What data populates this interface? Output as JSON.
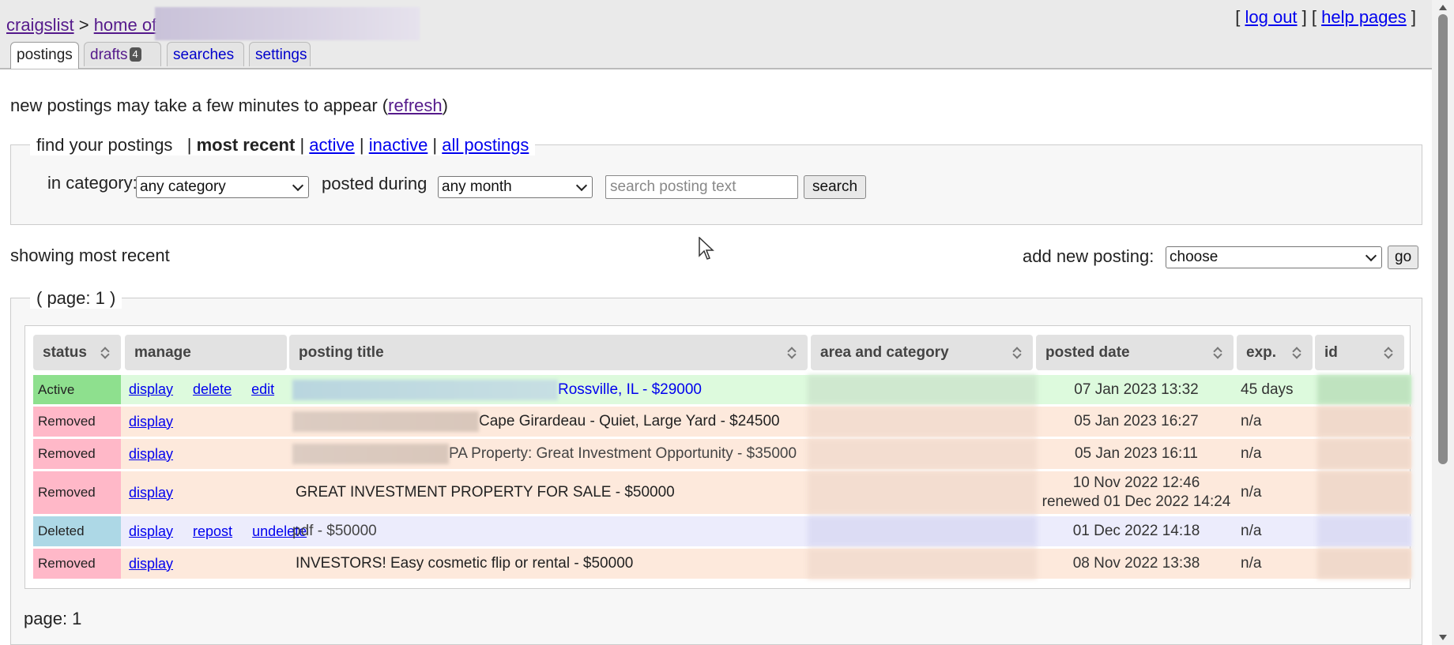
{
  "header": {
    "breadcrumb_root": "craigslist",
    "breadcrumb_sep": ">",
    "breadcrumb_home": "home of",
    "logout_label": "log out",
    "help_label": "help pages"
  },
  "tabs": [
    {
      "label": "postings"
    },
    {
      "label": "drafts",
      "badge": "4"
    },
    {
      "label": "searches"
    },
    {
      "label": "settings"
    }
  ],
  "notice": {
    "text": "new postings may take a few minutes to appear (",
    "refresh": "refresh",
    "close": ")"
  },
  "find": {
    "legend": "find your postings",
    "most_recent": "most recent",
    "active": "active",
    "inactive": "inactive",
    "all": "all postings",
    "in_category_label": "in category:",
    "category_value": "any category",
    "posted_during_label": "posted during",
    "month_value": "any month",
    "search_placeholder": "search posting text",
    "search_button": "search"
  },
  "showing": "showing most recent",
  "add_posting": {
    "label": "add new posting:",
    "value": "choose",
    "go": "go"
  },
  "results": {
    "page_legend": "( page: 1 )",
    "columns": [
      "status",
      "manage",
      "posting title",
      "area and category",
      "posted date",
      "exp.",
      "id"
    ],
    "rows": [
      {
        "status": "Active",
        "actions": [
          "display",
          "delete",
          "edit"
        ],
        "title": "Rossville, IL - $29000",
        "date": "07 Jan 2023 13:32",
        "date2": "",
        "exp": "45 days"
      },
      {
        "status": "Removed",
        "actions": [
          "display"
        ],
        "title": "Cape Girardeau - Quiet, Large Yard - $24500",
        "date": "05 Jan 2023 16:27",
        "date2": "",
        "exp": "n/a"
      },
      {
        "status": "Removed",
        "actions": [
          "display"
        ],
        "title": "PA Property: Great Investment Opportunity - $35000",
        "date": "05 Jan 2023 16:11",
        "date2": "",
        "exp": "n/a"
      },
      {
        "status": "Removed",
        "actions": [
          "display"
        ],
        "title": "GREAT INVESTMENT PROPERTY FOR SALE - $50000",
        "date": "10 Nov 2022 12:46",
        "date2": "renewed 01 Dec 2022 14:24",
        "exp": "n/a"
      },
      {
        "status": "Deleted",
        "actions": [
          "display",
          "repost",
          "undelete"
        ],
        "title": "pdf - $50000",
        "date": "01 Dec 2022 14:18",
        "date2": "",
        "exp": "n/a"
      },
      {
        "status": "Removed",
        "actions": [
          "display"
        ],
        "title": "INVESTORS! Easy cosmetic flip or rental - $50000",
        "date": "08 Nov 2022 13:38",
        "date2": "",
        "exp": "n/a"
      }
    ],
    "bottom_page": "page: 1"
  },
  "colors": {
    "active_status": "#8ee08e",
    "active_row": "#ddfadd",
    "removed_status": "#ffb8c8",
    "removed_row": "#fde9dc",
    "deleted_status": "#add8e6",
    "deleted_row": "#ececfc"
  }
}
